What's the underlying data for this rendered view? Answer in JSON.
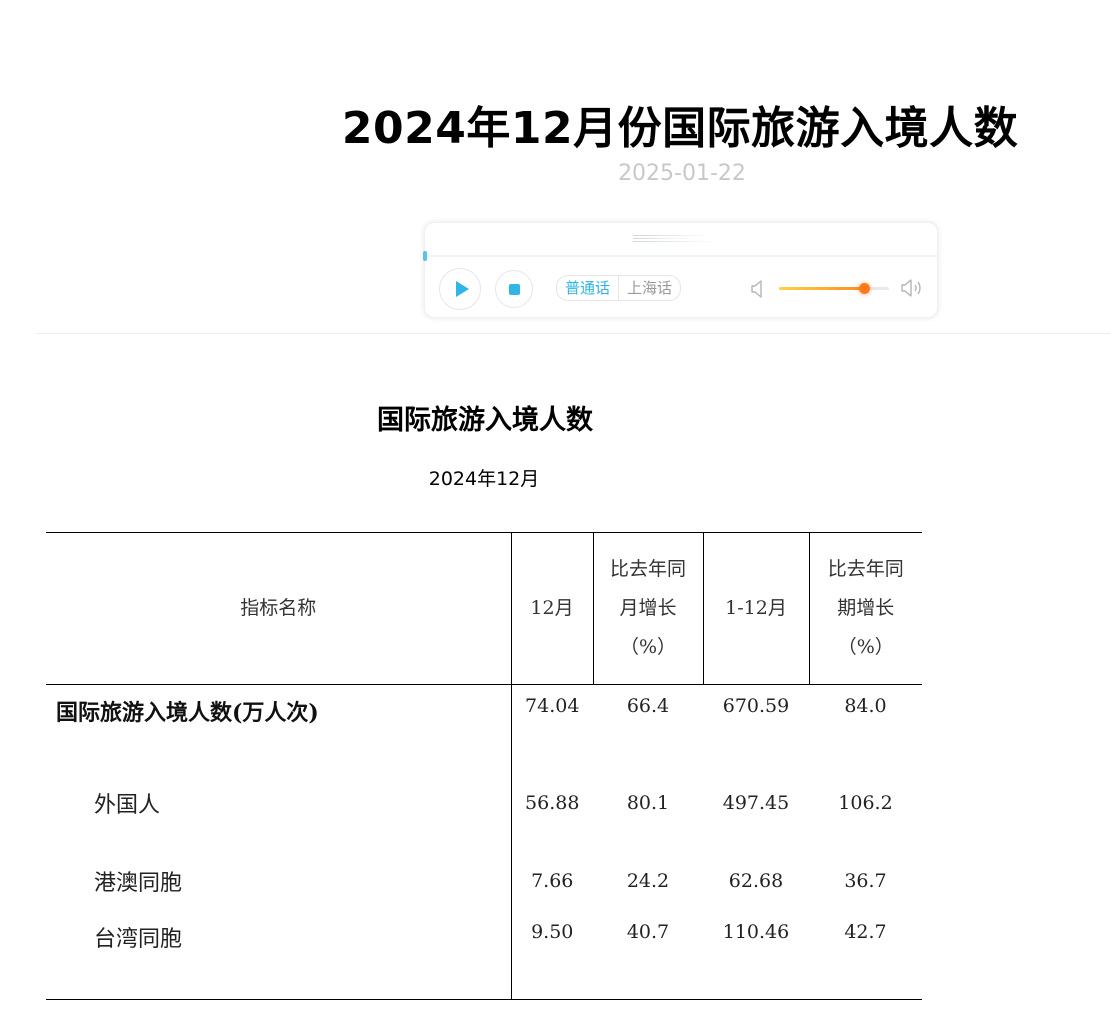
{
  "article": {
    "title": "2024年12月份国际旅游入境人数",
    "date": "2025-01-22"
  },
  "player": {
    "lang_options": [
      "普通话",
      "上海话"
    ],
    "selected_lang": "普通话",
    "volume_percent": 77,
    "icons": [
      "play-icon",
      "stop-icon",
      "volume-low-icon",
      "volume-high-icon"
    ],
    "accent_color": "#2fb6e6"
  },
  "report": {
    "title": "国际旅游入境人数",
    "period": "2024年12月",
    "columns": [
      "指标名称",
      "12月",
      "比去年同月增长（%）",
      "1-12月",
      "比去年同期增长（%）"
    ],
    "column_lines": [
      [
        "指标名称"
      ],
      [
        "12月"
      ],
      [
        "比去年同",
        "月增长",
        "（%）"
      ],
      [
        "1-12月"
      ],
      [
        "比去年同",
        "期增长",
        "（%）"
      ]
    ],
    "rows": [
      {
        "name": "国际旅游入境人数(万人次)",
        "month": "74.04",
        "month_growth": "66.4",
        "ytd": "670.59",
        "ytd_growth": "84.0"
      },
      {
        "name": "外国人",
        "month": "56.88",
        "month_growth": "80.1",
        "ytd": "497.45",
        "ytd_growth": "106.2"
      },
      {
        "name": "港澳同胞",
        "month": "7.66",
        "month_growth": "24.2",
        "ytd": "62.68",
        "ytd_growth": "36.7"
      },
      {
        "name": "台湾同胞",
        "month": "9.50",
        "month_growth": "40.7",
        "ytd": "110.46",
        "ytd_growth": "42.7"
      }
    ]
  }
}
